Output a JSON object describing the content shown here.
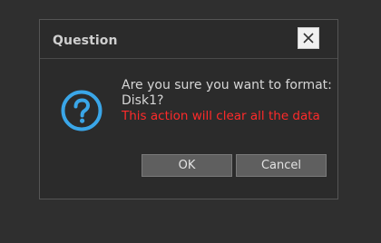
{
  "dialog": {
    "title": "Question",
    "close_icon": "close-icon",
    "question_icon": "question-circle-icon",
    "message_line1": "Are you sure you want to format:",
    "message_line2": "Disk1?",
    "warning": "This action will clear all the data",
    "ok_label": "OK",
    "cancel_label": "Cancel"
  },
  "colors": {
    "background": "#2f2f2f",
    "dialog_background": "#2b2b2b",
    "accent_icon": "#3aa6e8",
    "warning_text": "#ff2a2a",
    "button_background": "#5f5f5f"
  }
}
